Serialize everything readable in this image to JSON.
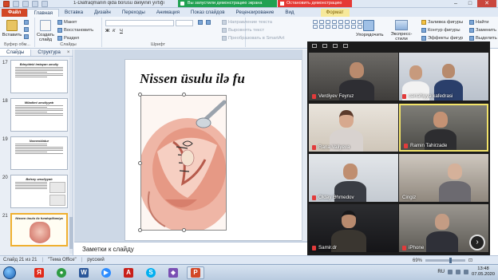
{
  "window": {
    "doc_title": "1-Diafraqmanin  qida borusu dəliyinin yırtığı",
    "share_notice": "Вы запустили демонстрацию экрана",
    "stop_share": "Остановить демонстрацию"
  },
  "tabs": [
    "Файл",
    "Главная",
    "Вставка",
    "Дизайн",
    "Переходы",
    "Анимация",
    "Показ слайдов",
    "Рецензирование",
    "Вид",
    "Формат"
  ],
  "ribbon": {
    "paste": "Вставить",
    "cut": "Макет",
    "restore": "Восстановить",
    "section": "Раздел",
    "new_slide": "Создать слайд",
    "clipboard": "Буфер обм...",
    "slides_group": "Слайды",
    "font_group": "Шрифт",
    "direction": "Направление текста",
    "align": "Выровнять текст",
    "smartart": "Преобразовать в SmartArt",
    "arrange": "Упорядочить",
    "quick_styles": "Экспресс-стили",
    "fill": "Заливка фигуры",
    "outline": "Контур фигуры",
    "effects": "Эффекты фигур",
    "find": "Найти",
    "replace": "Заменить",
    "select": "Выделить"
  },
  "left_panel": {
    "tab_slides": "Слайды",
    "tab_outline": "Структура",
    "close": "×",
    "thumbnails": [
      {
        "num": "17",
        "title": "Bıleyideki imtayan əməliy"
      },
      {
        "num": "18",
        "title": "Miladimi əməliyyatı"
      },
      {
        "num": "19",
        "title": "Nomenklatur"
      },
      {
        "num": "20",
        "title": "Belsey əməliyyatı"
      },
      {
        "num": "21",
        "title": "Nissen üsulu ilə fundoplikasiya"
      }
    ]
  },
  "slide": {
    "title": "Nissen üsulu ilə fu"
  },
  "notes_placeholder": "Заметки к слайду",
  "conference": {
    "participants": [
      {
        "name": "Verdiyev Feyruz",
        "muted": true
      },
      {
        "name": "cərrahiyyə kafedrasi",
        "muted": true
      },
      {
        "name": "Rana Valiyeva",
        "muted": true
      },
      {
        "name": "Ramin Tahirzade",
        "muted": true,
        "active": true
      },
      {
        "name": "Olday Əhmedov",
        "muted": true
      },
      {
        "name": "Cingiz",
        "muted": false
      },
      {
        "name": "Samir.dr",
        "muted": true
      },
      {
        "name": "iPhone",
        "muted": true
      }
    ],
    "next_icon": "›"
  },
  "status": {
    "slide_info": "Слайд 21 из 21",
    "theme": "\"Тема Office\"",
    "lang": "русский",
    "zoom": "69%"
  },
  "taskbar": {
    "lang": "RU",
    "time": "13:48",
    "date": "07.05.2020",
    "apps": [
      {
        "icon": "yandex-icon",
        "letter": "Я",
        "color": "#e02a1a"
      },
      {
        "icon": "chrome-icon",
        "letter": "●",
        "color": "#2e9b43"
      },
      {
        "icon": "word-icon",
        "letter": "W",
        "color": "#2a5699"
      },
      {
        "icon": "zoom-icon",
        "letter": "▶",
        "color": "#2d8cff"
      },
      {
        "icon": "pdf-icon",
        "letter": "A",
        "color": "#c8201a"
      },
      {
        "icon": "skype-icon",
        "letter": "S",
        "color": "#00aff0"
      },
      {
        "icon": "photos-icon",
        "letter": "◆",
        "color": "#7a4fb3"
      },
      {
        "icon": "powerpoint-icon",
        "letter": "P",
        "color": "#d24726"
      }
    ]
  }
}
